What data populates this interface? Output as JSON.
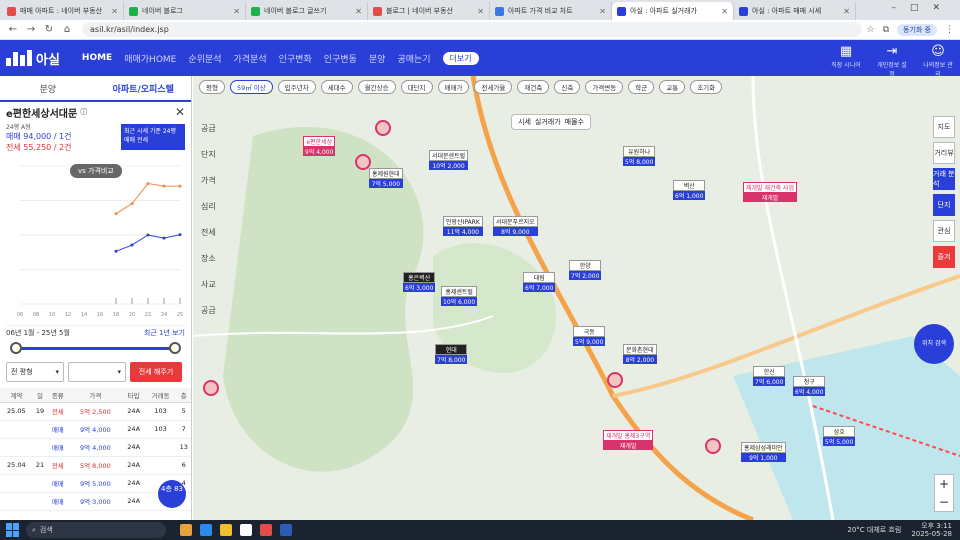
{
  "browser": {
    "tabs": [
      {
        "title": "매매 아파트 : 네이버 부동산",
        "color": "#e44b4b"
      },
      {
        "title": "네이버 블로그",
        "color": "#1fb14b"
      },
      {
        "title": "네이버 블로그 글쓰기",
        "color": "#1fb14b"
      },
      {
        "title": "블로그 | 네이버 부동산",
        "color": "#e44b4b"
      },
      {
        "title": "아파트 가격 비교 차트",
        "color": "#3b78e7"
      },
      {
        "title": "아실 : 아파트 실거래가",
        "color": "#2a3fd8",
        "active": true
      },
      {
        "title": "아실 : 아파트 매매 시세",
        "color": "#2a3fd8"
      }
    ],
    "url": "asil.kr/asil/index.jsp",
    "profile": "동기화 중"
  },
  "app": {
    "logo": "아실",
    "menu": [
      "HOME",
      "매매가HOME",
      "순위분석",
      "가격분석",
      "인구변화",
      "인구변동",
      "분양",
      "공매는기",
      "더보기"
    ],
    "header_icons": [
      "직장 시니어",
      "개인정보 설정",
      "나의정보 관리"
    ]
  },
  "sidebar": {
    "tabs": [
      "분양",
      "아파트/오피스텔"
    ],
    "complex_name": "e편한세상서대문",
    "small_note": "24평 A형",
    "price_sale": "매매 94,000 / 1건",
    "price_rent": "전세 55,250 / 2건",
    "period_box": "최근 시세 기준 24평 매매 전세",
    "vs_button": "vs 가격비교",
    "range_from": "06년 1월 - 25년 5월",
    "range_link": "최근 1년 보기",
    "filter1": "전 평형",
    "filter2": "",
    "filter_button": "전세 해주기",
    "table_headers": [
      "계약",
      "일",
      "종류",
      "가격",
      "타입",
      "거래동",
      "층"
    ],
    "rows": [
      {
        "date": "25.05",
        "day": "19",
        "kind": "전세",
        "price": "5억 2,500",
        "type": "24A",
        "dong": "103",
        "floor": "5",
        "cls": "sell"
      },
      {
        "date": "",
        "day": "",
        "kind": "매매",
        "price": "9억 4,000",
        "type": "24A",
        "dong": "103",
        "floor": "7",
        "cls": "buy"
      },
      {
        "date": "",
        "day": "",
        "kind": "매매",
        "price": "9억 4,000",
        "type": "24A",
        "dong": "",
        "floor": "13",
        "cls": "buy"
      },
      {
        "date": "25.04",
        "day": "21",
        "kind": "전세",
        "price": "5억 8,000",
        "type": "24A",
        "dong": "",
        "floor": "6",
        "cls": "sell"
      },
      {
        "date": "",
        "day": "",
        "kind": "매매",
        "price": "9억 5,000",
        "type": "24A",
        "dong": "",
        "floor": "4",
        "cls": "buy"
      },
      {
        "date": "",
        "day": "",
        "kind": "매매",
        "price": "9억 3,000",
        "type": "24A",
        "dong": "",
        "floor": "",
        "cls": "buy"
      }
    ],
    "count_badge": "4층 83"
  },
  "map": {
    "chips": [
      "평형",
      "59㎡ 이상",
      "입주년차",
      "세대수",
      "월간상승",
      "대단지",
      "매매가",
      "전세가율",
      "재건축",
      "신축",
      "가격변동",
      "학군",
      "교통",
      "초기화"
    ],
    "controls": [
      "시세",
      "실거래가",
      "매물수"
    ],
    "left_rail": [
      "공급",
      "단지",
      "가격",
      "심리",
      "전세",
      "장소",
      "사교",
      "공급"
    ],
    "right_rail": [
      "지도",
      "거리뷰",
      "거래 분석",
      "단지",
      "관심",
      "즐겨"
    ],
    "round_button": "위치 검색",
    "markers": [
      {
        "name": "e편한세상",
        "price": "9억 4,000",
        "style": "pink"
      },
      {
        "name": "서대문센트럴",
        "price": "10억 2,000",
        "style": ""
      },
      {
        "name": "홍제원현대",
        "price": "7억 5,000",
        "style": ""
      },
      {
        "name": "인왕산IPARK",
        "price": "11억 4,000",
        "style": ""
      },
      {
        "name": "홍은벽산",
        "price": "6억 3,000",
        "style": "dark"
      },
      {
        "name": "홍제센트럴",
        "price": "10억 6,000",
        "style": ""
      },
      {
        "name": "서대문푸르지오",
        "price": "8억 9,000",
        "style": ""
      },
      {
        "name": "현대",
        "price": "7억 8,000",
        "style": "dark"
      },
      {
        "name": "유원하나",
        "price": "5억 8,000",
        "style": ""
      },
      {
        "name": "벽산",
        "price": "6억 1,000",
        "style": ""
      },
      {
        "name": "한양",
        "price": "7억 2,000",
        "style": ""
      },
      {
        "name": "제개발 재건축 사업",
        "price": "재개발",
        "style": "pink"
      },
      {
        "name": "홍제삼성래미안",
        "price": "9억 1,000",
        "style": ""
      },
      {
        "name": "대림",
        "price": "6억 7,000",
        "style": ""
      },
      {
        "name": "극동",
        "price": "5억 9,000",
        "style": ""
      },
      {
        "name": "문화촌현대",
        "price": "8억 2,000",
        "style": ""
      },
      {
        "name": "재개발 홍제3구역",
        "price": "재개발",
        "style": "pink"
      },
      {
        "name": "한신",
        "price": "7억 6,000",
        "style": ""
      },
      {
        "name": "청구",
        "price": "6억 4,000",
        "style": ""
      },
      {
        "name": "삼호",
        "price": "5억 5,000",
        "style": ""
      }
    ]
  },
  "chart_data": {
    "type": "line",
    "title": "",
    "x": [
      "06",
      "08",
      "10",
      "12",
      "14",
      "16",
      "18",
      "20",
      "22",
      "24",
      "25"
    ],
    "series": [
      {
        "name": "매매",
        "values": [
          0,
          0,
          0,
          0,
          0,
          0,
          72000,
          80000,
          96000,
          94000,
          94000
        ]
      },
      {
        "name": "전세",
        "values": [
          0,
          0,
          0,
          0,
          0,
          0,
          42000,
          47000,
          55000,
          52500,
          55250
        ]
      }
    ],
    "ylim": [
      0,
      110000
    ],
    "colors": {
      "매매": "#f08a4b",
      "전세": "#2a3fd8"
    }
  },
  "taskbar": {
    "search": "검색",
    "weather": "20°C 대체로 흐림",
    "time": "오후 3:11",
    "date": "2025-05-28"
  }
}
